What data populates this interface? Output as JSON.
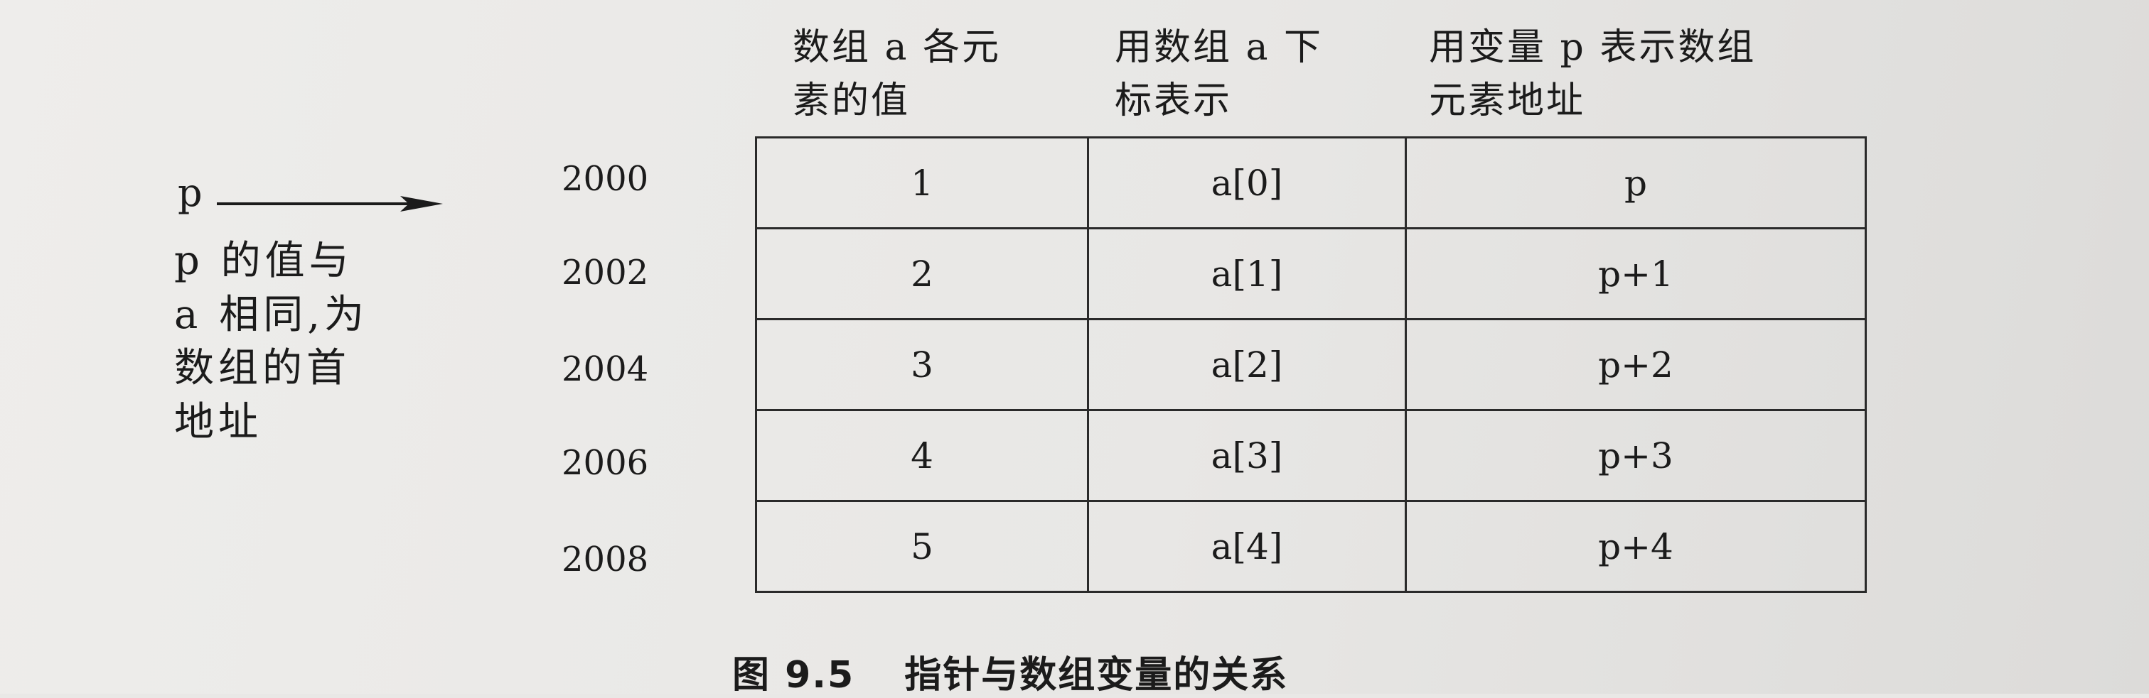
{
  "headers": [
    [
      "数组 a 各元",
      "素的值"
    ],
    [
      "用数组 a 下",
      "标表示"
    ],
    [
      "用变量 p 表示数组",
      "元素地址"
    ]
  ],
  "pointer_label": "p",
  "side_note": [
    "p 的值与",
    "a 相同,为",
    "数组的首",
    "地址"
  ],
  "addresses": [
    "2000",
    "2002",
    "2004",
    "2006",
    "2008"
  ],
  "rows": [
    [
      "1",
      "a[0]",
      "p"
    ],
    [
      "2",
      "a[1]",
      "p+1"
    ],
    [
      "3",
      "a[2]",
      "p+2"
    ],
    [
      "4",
      "a[3]",
      "p+3"
    ],
    [
      "5",
      "a[4]",
      "p+4"
    ]
  ],
  "caption": {
    "number": "图 9.5",
    "title": "指针与数组变量的关系"
  }
}
